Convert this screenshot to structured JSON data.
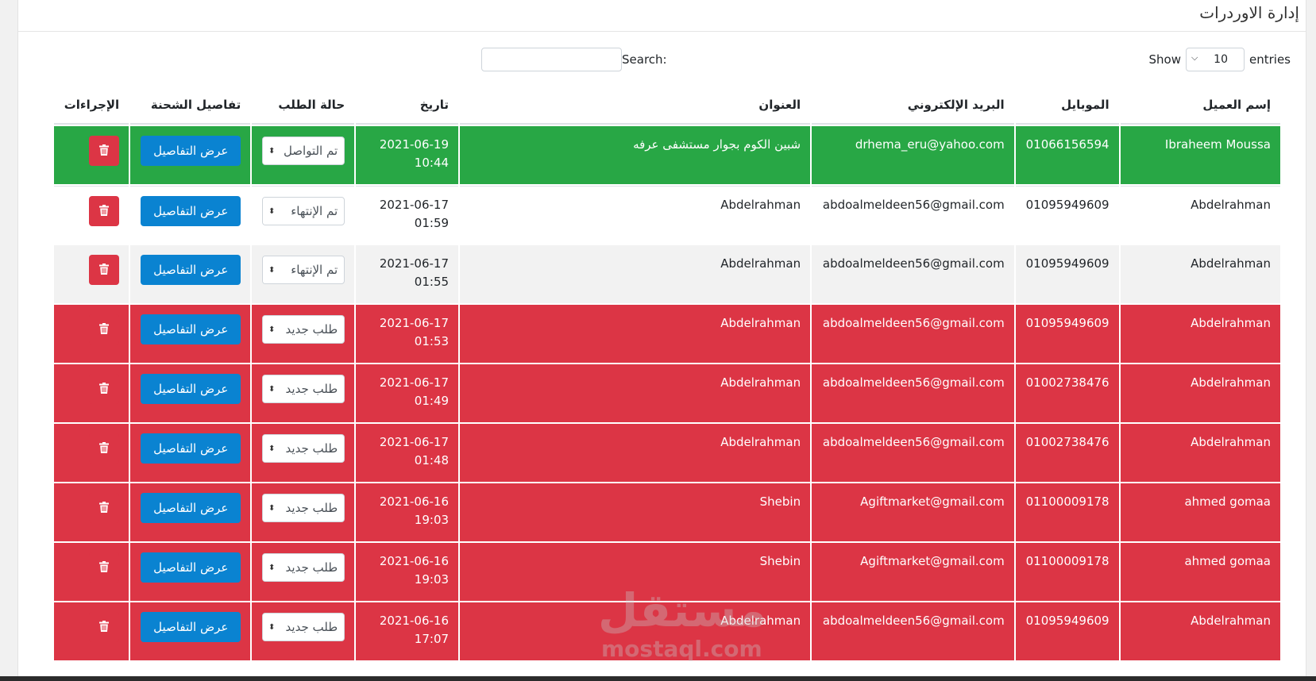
{
  "header": {
    "title": "إدارة الاوردرات"
  },
  "controls": {
    "show_label": "Show",
    "entries_value": "10",
    "entries_label": "entries",
    "search_label": "Search:",
    "search_value": ""
  },
  "table": {
    "columns": {
      "name": "إسم العميل",
      "mobile": "الموبايل",
      "email": "البريد الإلكتروني",
      "address": "العنوان",
      "date": "تاريخ",
      "status": "حالة الطلب",
      "details": "تفاصيل الشحنة",
      "actions": "الإجراءات"
    },
    "details_button_label": "عرض التفاصيل",
    "rows": [
      {
        "name": "Ibraheem Moussa",
        "mobile": "01066156594",
        "email": "drhema_eru@yahoo.com",
        "address": "شبين الكوم بجوار مستشفى عرفه",
        "date": "2021-06-19",
        "time": "10:44",
        "status": "تم التواصل",
        "tone": "green"
      },
      {
        "name": "Abdelrahman",
        "mobile": "01095949609",
        "email": "abdoalmeldeen56@gmail.com",
        "address": "Abdelrahman",
        "date": "2021-06-17",
        "time": "01:59",
        "status": "تم الإنتهاء",
        "tone": "white"
      },
      {
        "name": "Abdelrahman",
        "mobile": "01095949609",
        "email": "abdoalmeldeen56@gmail.com",
        "address": "Abdelrahman",
        "date": "2021-06-17",
        "time": "01:55",
        "status": "تم الإنتهاء",
        "tone": "gray"
      },
      {
        "name": "Abdelrahman",
        "mobile": "01095949609",
        "email": "abdoalmeldeen56@gmail.com",
        "address": "Abdelrahman",
        "date": "2021-06-17",
        "time": "01:53",
        "status": "طلب جديد",
        "tone": "red"
      },
      {
        "name": "Abdelrahman",
        "mobile": "01002738476",
        "email": "abdoalmeldeen56@gmail.com",
        "address": "Abdelrahman",
        "date": "2021-06-17",
        "time": "01:49",
        "status": "طلب جديد",
        "tone": "red"
      },
      {
        "name": "Abdelrahman",
        "mobile": "01002738476",
        "email": "abdoalmeldeen56@gmail.com",
        "address": "Abdelrahman",
        "date": "2021-06-17",
        "time": "01:48",
        "status": "طلب جديد",
        "tone": "red"
      },
      {
        "name": "ahmed gomaa",
        "mobile": "01100009178",
        "email": "Agiftmarket@gmail.com",
        "address": "Shebin",
        "date": "2021-06-16",
        "time": "19:03",
        "status": "طلب جديد",
        "tone": "red"
      },
      {
        "name": "ahmed gomaa",
        "mobile": "01100009178",
        "email": "Agiftmarket@gmail.com",
        "address": "Shebin",
        "date": "2021-06-16",
        "time": "19:03",
        "status": "طلب جديد",
        "tone": "red"
      },
      {
        "name": "Abdelrahman",
        "mobile": "01095949609",
        "email": "abdoalmeldeen56@gmail.com",
        "address": "Abdelrahman",
        "date": "2021-06-16",
        "time": "17:07",
        "status": "طلب جديد",
        "tone": "red"
      }
    ]
  },
  "watermark": {
    "arabic": "مستقل",
    "latin": "mostaql.com"
  },
  "colors": {
    "green": "#28a745",
    "red": "#dc3545",
    "blue_button": "#0a83d1"
  },
  "icons": {
    "delete": "trash-icon",
    "select_arrow": "sort-arrows-icon"
  }
}
